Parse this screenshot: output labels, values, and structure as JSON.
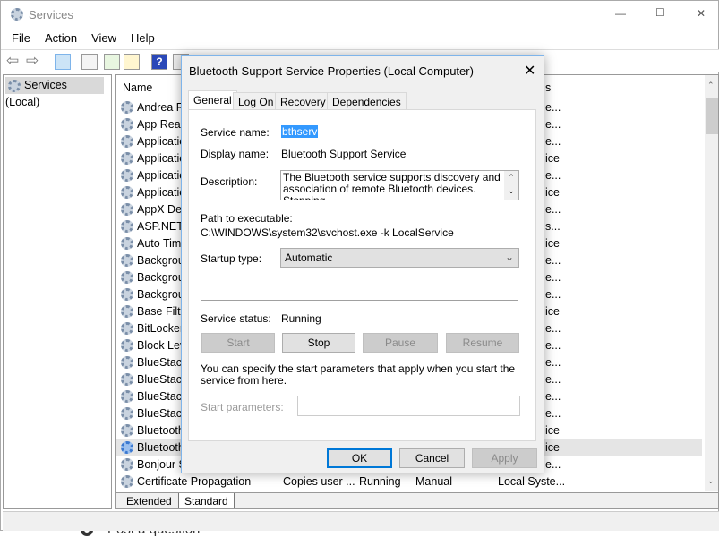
{
  "window": {
    "title": "Services",
    "minimize": "—",
    "maximize": "☐",
    "close": "✕"
  },
  "menu": [
    "File",
    "Action",
    "View",
    "Help"
  ],
  "toolbar_icons": [
    "back-icon",
    "forward-icon",
    "show-hide-tree-icon",
    "properties-icon",
    "refresh-icon",
    "export-list-icon",
    "help-icon",
    "show-console-icon"
  ],
  "tree": {
    "root": "Services (Local)"
  },
  "list": {
    "header_name": "Name",
    "header_logon_fragment": "s",
    "rows": [
      {
        "name": "Andrea RT",
        "logon": "e..."
      },
      {
        "name": "App Read",
        "logon": "e..."
      },
      {
        "name": "Applicatio",
        "logon": "e..."
      },
      {
        "name": "Applicatio",
        "logon": "ice"
      },
      {
        "name": "Applicatio",
        "logon": "e..."
      },
      {
        "name": "Applicatio",
        "logon": "ice"
      },
      {
        "name": "AppX Dep",
        "logon": "e..."
      },
      {
        "name": "ASP.NET",
        "logon": "s..."
      },
      {
        "name": "Auto Tim",
        "logon": "ice"
      },
      {
        "name": "Backgrou",
        "logon": "e..."
      },
      {
        "name": "Backgrou",
        "logon": "e..."
      },
      {
        "name": "Backgrou",
        "logon": "e..."
      },
      {
        "name": "Base Filte",
        "logon": "ice"
      },
      {
        "name": "BitLocker",
        "logon": "e..."
      },
      {
        "name": "Block Lev",
        "logon": "e..."
      },
      {
        "name": "BlueStack",
        "logon": "e..."
      },
      {
        "name": "BlueStack",
        "logon": "e..."
      },
      {
        "name": "BlueStack",
        "logon": "e..."
      },
      {
        "name": "BlueStack",
        "logon": "e..."
      },
      {
        "name": "Bluetooth",
        "logon": "ice"
      },
      {
        "name": "Bluetooth",
        "logon": "ice",
        "selected": true
      },
      {
        "name": "Bonjour S",
        "logon": "e..."
      }
    ],
    "last_row": {
      "name": "Certificate Propagation",
      "description": "Copies user ...",
      "status": "Running",
      "startup": "Manual",
      "logon": "Local Syste..."
    },
    "view_tabs": [
      "Extended",
      "Standard"
    ]
  },
  "dialog": {
    "title": "Bluetooth Support Service Properties (Local Computer)",
    "tabs": [
      "General",
      "Log On",
      "Recovery",
      "Dependencies"
    ],
    "service_name_label": "Service name:",
    "service_name": "bthserv",
    "display_name_label": "Display name:",
    "display_name": "Bluetooth Support Service",
    "description_label": "Description:",
    "description": "The Bluetooth service supports discovery and association of remote Bluetooth devices.  Stopping",
    "path_label": "Path to executable:",
    "path": "C:\\WINDOWS\\system32\\svchost.exe -k LocalService",
    "startup_label": "Startup type:",
    "startup_value": "Automatic",
    "status_label": "Service status:",
    "status_value": "Running",
    "start": "Start",
    "stop": "Stop",
    "pause": "Pause",
    "resume": "Resume",
    "hint": "You can specify the start parameters that apply when you start the service from here.",
    "params_label": "Start parameters:",
    "params_value": "",
    "ok": "OK",
    "cancel": "Cancel",
    "apply": "Apply"
  },
  "background_text": "Post a question",
  "colors": {
    "selection": "#3399ff",
    "dialog_border": "#7eb4ea",
    "ok_border": "#0078d7"
  }
}
